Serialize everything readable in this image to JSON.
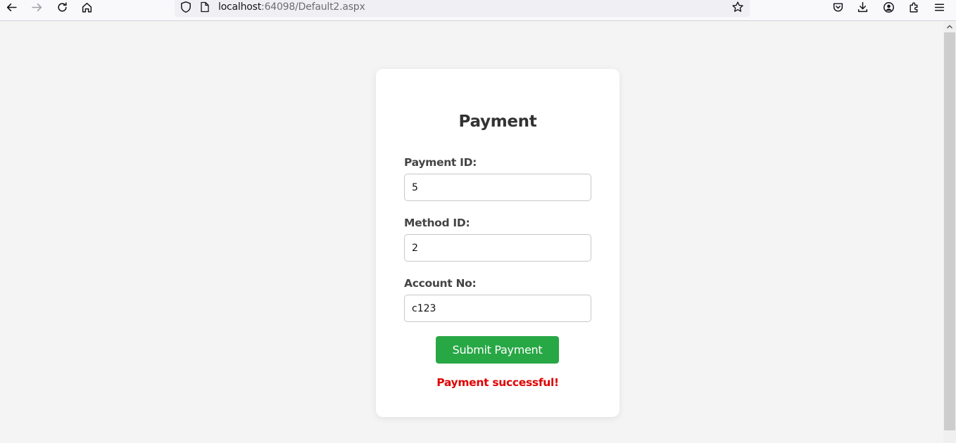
{
  "browser": {
    "url_host": "localhost",
    "url_rest": ":64098/Default2.aspx",
    "icons": [
      "back-arrow-icon",
      "forward-arrow-icon",
      "reload-icon",
      "home-icon",
      "shield-icon",
      "page-icon",
      "star-icon",
      "pocket-icon",
      "download-icon",
      "account-icon",
      "extensions-icon",
      "menu-icon"
    ]
  },
  "form": {
    "title": "Payment",
    "fields": [
      {
        "label": "Payment ID:",
        "value": "5"
      },
      {
        "label": "Method ID:",
        "value": "2"
      },
      {
        "label": "Account No:",
        "value": "c123"
      }
    ],
    "submit_label": "Submit Payment",
    "status_message": "Payment successful!"
  },
  "colors": {
    "accent_button": "#28a745",
    "status_error_red": "#e00000",
    "page_background": "#f4f4f4"
  }
}
